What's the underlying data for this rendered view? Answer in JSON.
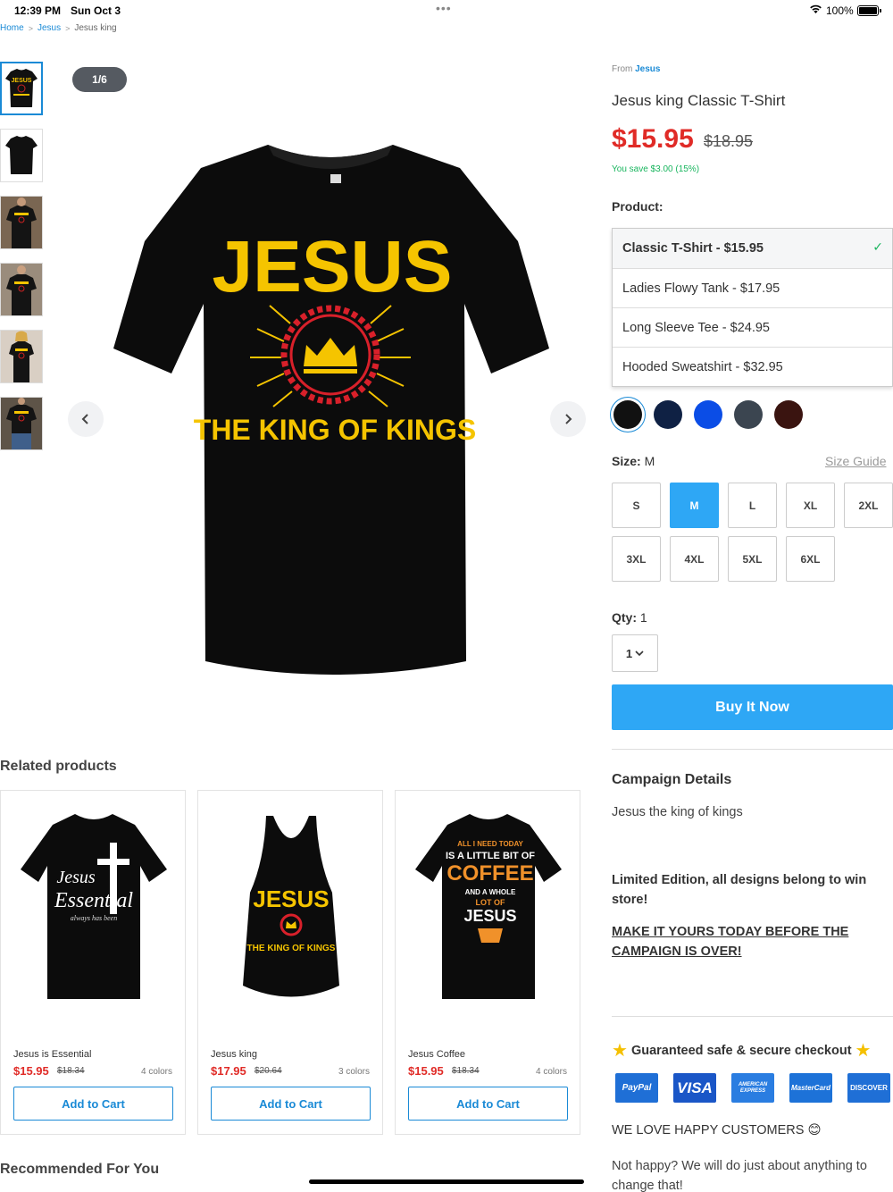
{
  "status": {
    "time": "12:39 PM",
    "date": "Sun Oct 3",
    "battery": "100%"
  },
  "breadcrumb": [
    "Home",
    "Jesus",
    "Jesus king"
  ],
  "gallery": {
    "counter": "1/6",
    "design": {
      "top": "JESUS",
      "bottom": "THE KING OF KINGS"
    },
    "thumbnails": [
      "design-front",
      "plain-back",
      "worn-photo-1",
      "worn-photo-2",
      "worn-photo-3",
      "worn-photo-4"
    ]
  },
  "product": {
    "from_label": "From",
    "from_link": "Jesus",
    "title": "Jesus king Classic T-Shirt",
    "price": "$15.95",
    "old_price": "$18.95",
    "savings": "You save $3.00 (15%)",
    "product_label": "Product:",
    "options": [
      {
        "label": "Classic T-Shirt - $15.95",
        "selected": true
      },
      {
        "label": "Ladies Flowy Tank - $17.95"
      },
      {
        "label": "Long Sleeve Tee - $24.95"
      },
      {
        "label": "Hooded Sweatshirt - $32.95"
      }
    ],
    "colors": [
      "#111111",
      "#0f2144",
      "#0b4de6",
      "#3b4550",
      "#3a1410"
    ],
    "size_label": "Size:",
    "size_value": "M",
    "size_guide": "Size Guide",
    "sizes": [
      "S",
      "M",
      "L",
      "XL",
      "2XL",
      "3XL",
      "4XL",
      "5XL",
      "6XL"
    ],
    "selected_size": "M",
    "qty_label": "Qty:",
    "qty_value": "1",
    "qty_select": "1",
    "buy_label": "Buy It Now"
  },
  "campaign": {
    "title": "Campaign Details",
    "text": "Jesus the king of kings",
    "limited": "Limited Edition, all designs belong to win store!",
    "cta": "MAKE IT YOURS TODAY BEFORE THE CAMPAIGN IS OVER!"
  },
  "checkout": {
    "secure": "Guaranteed safe & secure checkout",
    "cards": [
      "PayPal",
      "VISA",
      "AMERICAN EXPRESS",
      "MasterCard",
      "DISCOVER"
    ],
    "love": "WE LOVE HAPPY CUSTOMERS",
    "not_happy": "Not happy? We will do just about anything to change that!"
  },
  "related": {
    "title": "Related products",
    "items": [
      {
        "name": "Jesus is Essential",
        "price": "$15.95",
        "old": "$18.34",
        "colors": "4 colors",
        "button": "Add to Cart"
      },
      {
        "name": "Jesus king",
        "price": "$17.95",
        "old": "$20.64",
        "colors": "3 colors",
        "button": "Add to Cart"
      },
      {
        "name": "Jesus Coffee",
        "price": "$15.95",
        "old": "$18.34",
        "colors": "4 colors",
        "button": "Add to Cart"
      }
    ]
  },
  "recommended": {
    "title": "Recommended For You"
  }
}
